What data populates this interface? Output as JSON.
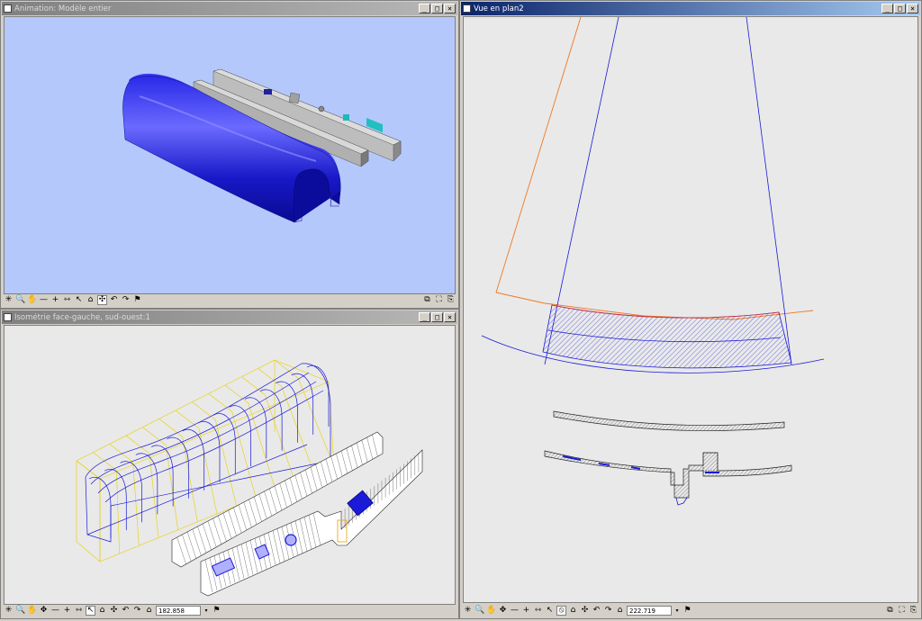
{
  "windows": {
    "animation": {
      "title": "Animation: Modèle entier"
    },
    "isometric": {
      "title": "Isométrie face-gauche, sud-ouest:1",
      "zoom_value": "182.858"
    },
    "plan": {
      "title": "Vue en plan2",
      "zoom_value": "222.719"
    }
  },
  "title_buttons": {
    "minimize": "_",
    "maximize": "□",
    "close": "×"
  },
  "toolbar_glyphs": {
    "select": "✳",
    "zoom": "🔍",
    "pan": "✋",
    "orbit": "✥",
    "minus": "—",
    "plus": "+",
    "measure": "⇿",
    "cursor": "↖",
    "camera": "⌂",
    "walk": "✣",
    "undo": "↶",
    "redo": "↷",
    "flag": "⚑",
    "arrow": "▾",
    "tile": "⧉",
    "fit": "⛶",
    "copy": "⎘",
    "erase": "⦸"
  },
  "colors": {
    "model_blue": "#1a1ad8",
    "animation_bg": "#b4c8fc",
    "viewport_bg": "#e9e9e9",
    "active_title": "#0a246a",
    "orange_line": "#f07820"
  }
}
